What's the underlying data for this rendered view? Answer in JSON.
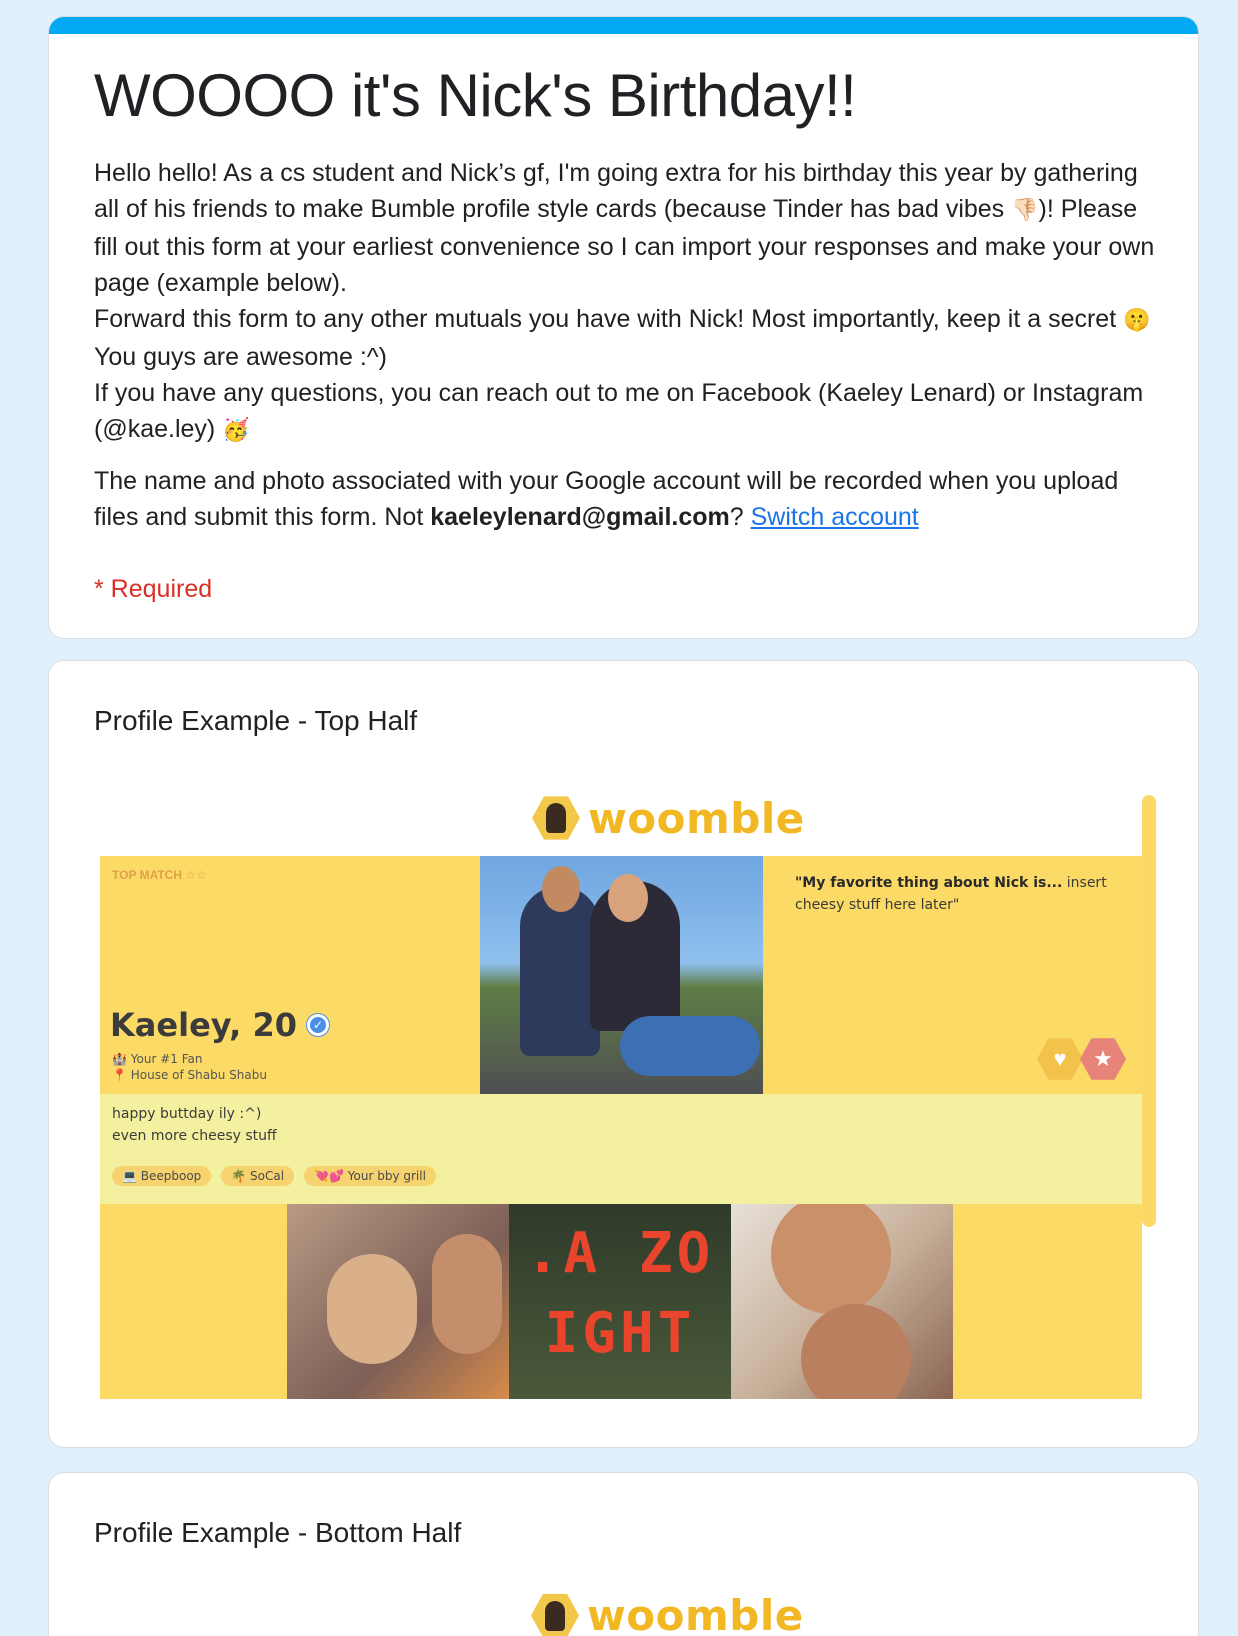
{
  "form": {
    "title": "WOOOO it's Nick's Birthday!!",
    "description_lines": [
      "Hello hello! As a cs student and Nick’s gf, I'm going extra for his birthday this year by gathering all of his friends to make Bumble profile style cards (because Tinder has bad vibes ",
      ")! Please fill out this form at your earliest convenience so I can import your responses and make your own page (example below).",
      "Forward this form to any other mutuals you have with Nick! Most importantly, keep it a secret ",
      " You guys are awesome :^)",
      "If you have any questions, you can reach out to me on Facebook (Kaeley Lenard) or Instagram (@kae.ley) "
    ],
    "emojis": [
      "👎🏻",
      "🤫",
      "🥳"
    ],
    "account_note_prefix": "The name and photo associated with your Google account will be recorded when you upload files and submit this form. Not ",
    "account_email": "kaeleylenard@gmail.com",
    "account_note_suffix": "? ",
    "switch_account_label": "Switch account",
    "required_label": "* Required",
    "accent_color": "#03a9f4"
  },
  "items": [
    {
      "title": "Profile Example - Top Half"
    },
    {
      "title": "Profile Example - Bottom Half"
    }
  ],
  "profile": {
    "logo_text": "woomble",
    "top_match": "TOP MATCH ☆☆",
    "name_age": "Kaeley, 20",
    "fact1": "🏰 Your #1 Fan",
    "fact2": "📍 House of Shabu Shabu",
    "quote_bold": "\"My favorite thing about Nick is...",
    "quote_rest": " insert cheesy stuff here later\"",
    "bio1": "happy buttday ily :^)",
    "bio2": "even more cheesy stuff",
    "chips": [
      "💻 Beepboop",
      "🌴 SoCal",
      "💘💕 Your bby grill"
    ],
    "sign_text": ".A ZO\nIGHT",
    "like_icon": "heart-icon",
    "star_icon": "star-icon"
  }
}
